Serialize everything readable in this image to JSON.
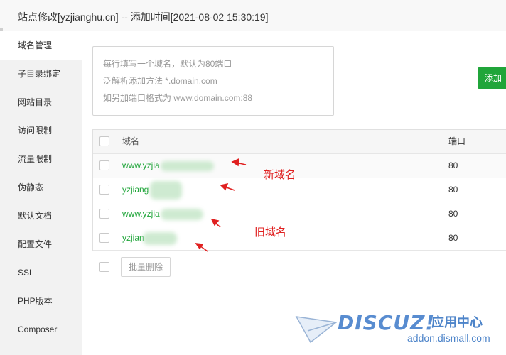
{
  "window": {
    "title": "站点修改[yzjianghu.cn] -- 添加时间[2021-08-02 15:30:19]"
  },
  "sidebar": {
    "items": [
      {
        "label": "域名管理",
        "active": true
      },
      {
        "label": "子目录绑定"
      },
      {
        "label": "网站目录"
      },
      {
        "label": "访问限制"
      },
      {
        "label": "流量限制"
      },
      {
        "label": "伪静态"
      },
      {
        "label": "默认文档"
      },
      {
        "label": "配置文件"
      },
      {
        "label": "SSL"
      },
      {
        "label": "PHP版本"
      },
      {
        "label": "Composer"
      }
    ]
  },
  "domain_input": {
    "placeholder_lines": [
      "每行填写一个域名，默认为80端口",
      "泛解析添加方法 *.domain.com",
      "如另加端口格式为 www.domain.com:88"
    ]
  },
  "toolbar": {
    "add_label": "添加",
    "add_color": "#20a53a"
  },
  "table": {
    "headers": {
      "domain": "域名",
      "port": "端口"
    },
    "rows": [
      {
        "domain": "www.yzjia",
        "port": "80"
      },
      {
        "domain": "yzjiang",
        "port": "80"
      },
      {
        "domain": "www.yzjia",
        "port": "80"
      },
      {
        "domain": "yzjian",
        "port": "80"
      }
    ]
  },
  "footer": {
    "batch_delete_label": "批量删除"
  },
  "annotations": {
    "new_domain": "新域名",
    "old_domain": "旧域名",
    "color": "#e02020"
  },
  "watermark": {
    "logo": "DISCUZ!",
    "logo_suffix": "应用中心",
    "url": "addon.dismall.com"
  }
}
